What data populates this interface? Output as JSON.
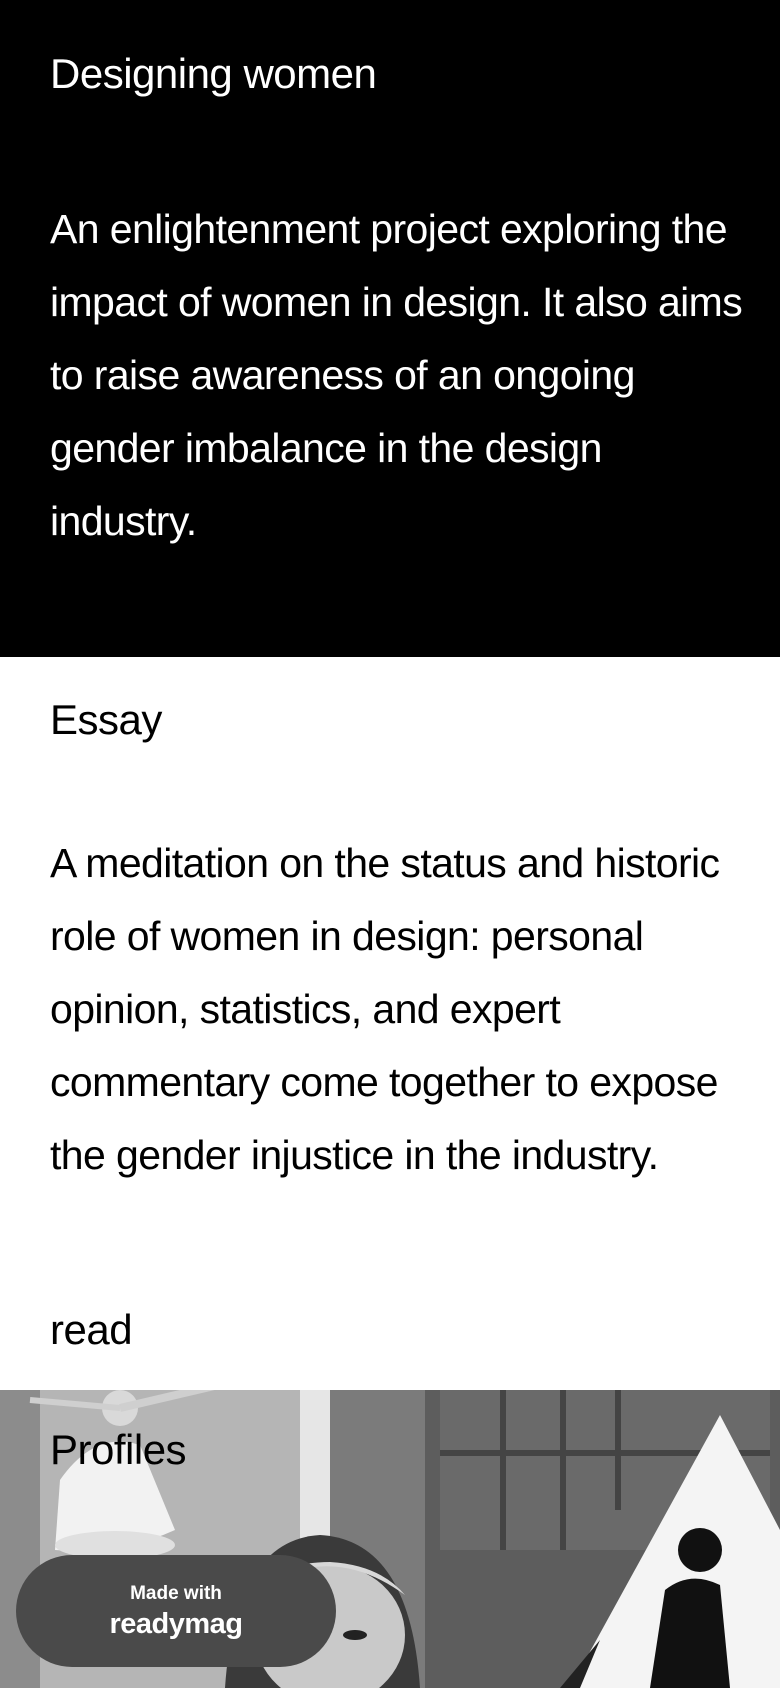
{
  "hero": {
    "title": "Designing women",
    "description": "An enlightenment project exploring the impact of women in design. It also aims to raise awareness of an ongoing gender imbalance in the design industry."
  },
  "essay": {
    "title": "Essay",
    "description": "A meditation on the status and historic role of women in design: personal opinion, statistics, and expert commentary come together to expose the gender injustice in the industry.",
    "link_label": "read"
  },
  "profiles": {
    "title": "Profiles",
    "image": "black-and-white photo collage"
  },
  "badge": {
    "small": "Made with",
    "brand": "readymag"
  },
  "colors": {
    "hero_bg": "#000000",
    "text_light": "#ffffff",
    "text_dark": "#000000",
    "badge_bg": "#4a4a4a"
  }
}
